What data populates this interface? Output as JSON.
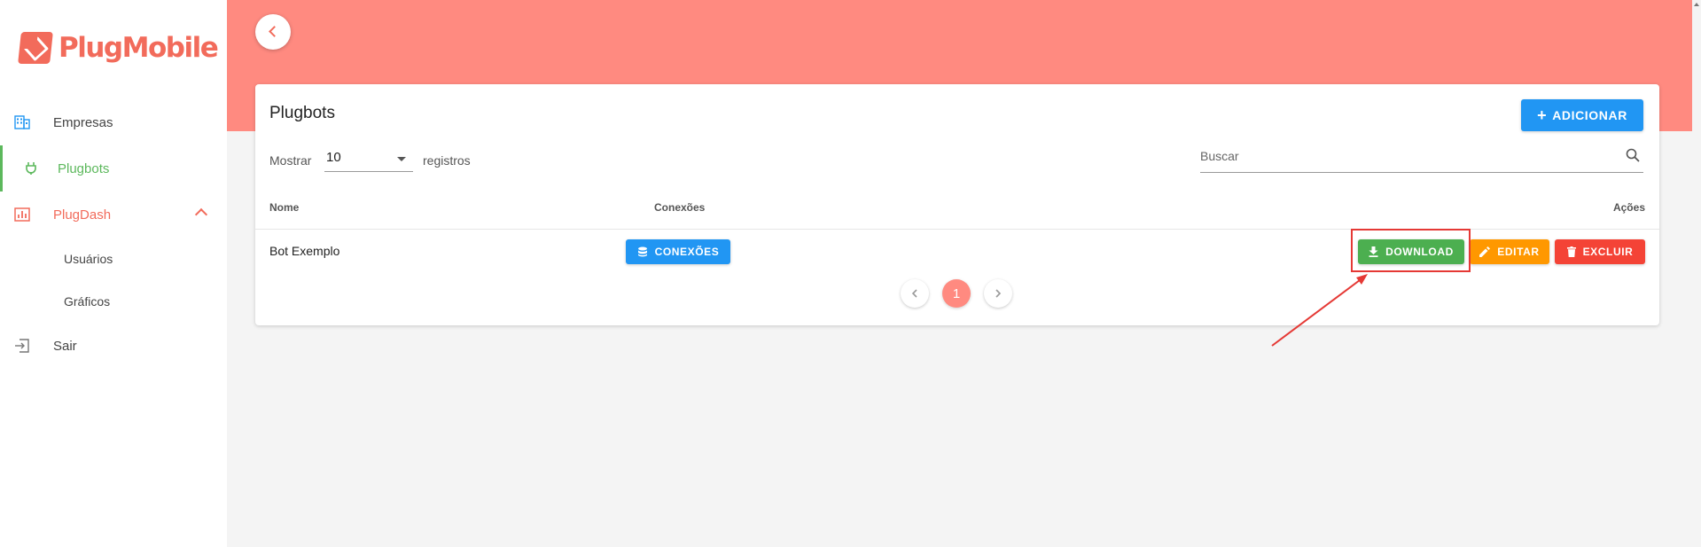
{
  "brand": {
    "name": "PlugMobile"
  },
  "sidebar": {
    "items": [
      {
        "label": "Empresas"
      },
      {
        "label": "Plugbots"
      },
      {
        "label": "PlugDash"
      },
      {
        "label": "Usuários"
      },
      {
        "label": "Gráficos"
      },
      {
        "label": "Sair"
      }
    ]
  },
  "card": {
    "title": "Plugbots",
    "add_label": "ADICIONAR",
    "show_label": "Mostrar",
    "page_size": "10",
    "records_label": "registros",
    "search_placeholder": "Buscar",
    "columns": [
      "Nome",
      "Conexões",
      "Ações"
    ],
    "rows": [
      {
        "name": "Bot Exemplo",
        "connections_label": "CONEXÕES"
      }
    ],
    "actions": {
      "download": "DOWNLOAD",
      "edit": "EDITAR",
      "delete": "EXCLUIR"
    },
    "pagination": {
      "current": "1"
    }
  },
  "colors": {
    "brand": "#f26b5b",
    "header": "#ff8a80",
    "primary": "#2196f3",
    "success": "#4caf50",
    "warning": "#ff9800",
    "danger": "#f44336"
  }
}
